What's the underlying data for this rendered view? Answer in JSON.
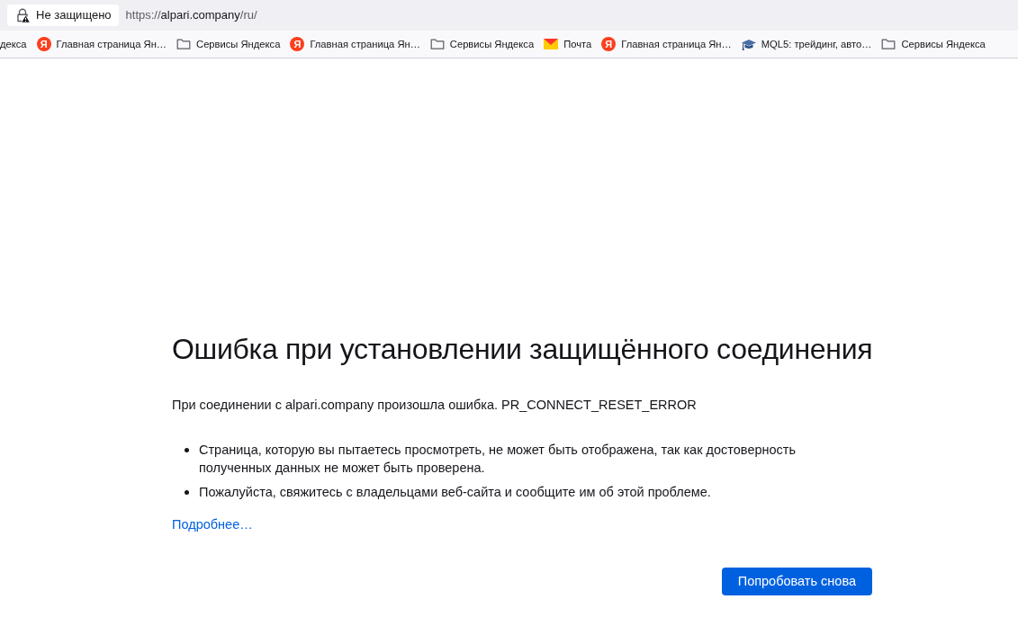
{
  "toolbar": {
    "identity": {
      "label": "Не защищено"
    },
    "url": {
      "scheme": "https://",
      "host": "alpari.company",
      "path": "/ru/"
    }
  },
  "bookmarks": [
    {
      "kind": "text",
      "label": "декса"
    },
    {
      "kind": "yandex",
      "glyph": "Я",
      "label": "Главная страница Ян…"
    },
    {
      "kind": "folder",
      "label": "Сервисы Яндекса"
    },
    {
      "kind": "yandex",
      "glyph": "Я",
      "label": "Главная страница Ян…"
    },
    {
      "kind": "folder",
      "label": "Сервисы Яндекса"
    },
    {
      "kind": "mail",
      "label": "Почта"
    },
    {
      "kind": "yandex",
      "glyph": "Я",
      "label": "Главная страница Ян…"
    },
    {
      "kind": "cap",
      "label": "MQL5: трейдинг, авто…"
    },
    {
      "kind": "folder",
      "label": "Сервисы Яндекса"
    }
  ],
  "error_page": {
    "title": "Ошибка при установлении защищённого соединения",
    "message": "При соединении с alpari.company произошла ошибка. PR_CONNECT_RESET_ERROR",
    "details": [
      "Страница, которую вы пытаетесь просмотреть, не может быть отображена, так как достоверность полученных данных не может быть проверена.",
      "Пожалуйста, свяжитесь с владельцами веб-сайта и сообщите им об этой проблеме."
    ],
    "learn_more": "Подробнее…",
    "retry_button": "Попробовать снова"
  }
}
